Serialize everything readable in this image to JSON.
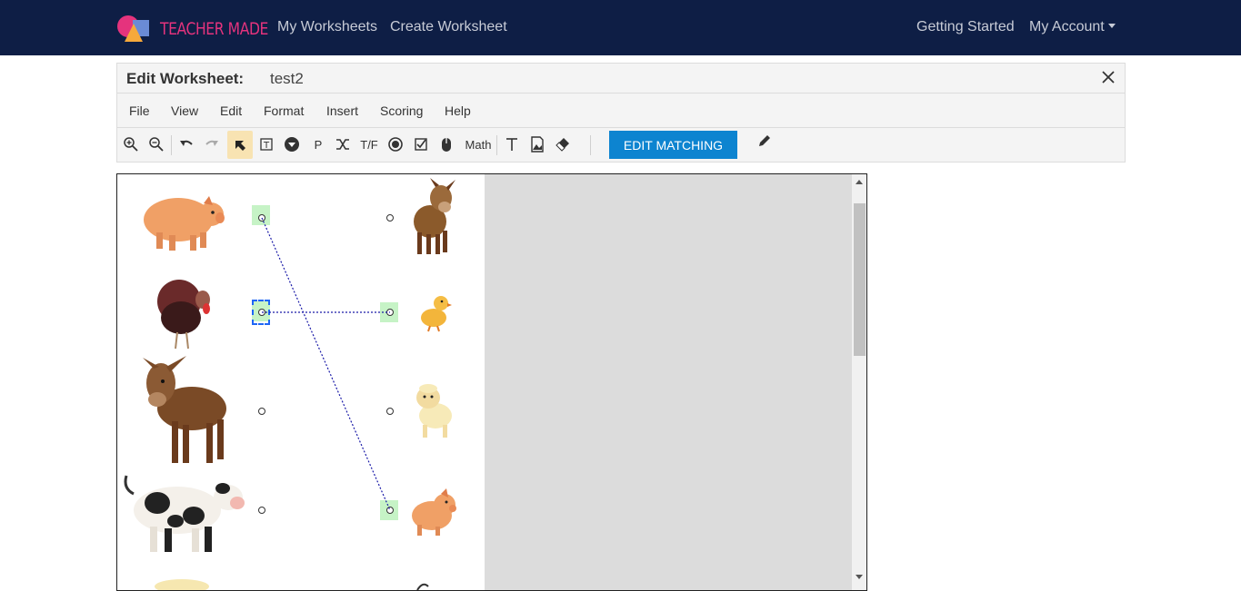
{
  "nav": {
    "logo_text": "TEACHER MADE",
    "links": [
      "My Worksheets",
      "Create Worksheet"
    ],
    "right_links": [
      "Getting Started",
      "My Account"
    ]
  },
  "editor": {
    "label": "Edit Worksheet:",
    "worksheet_name": "test2"
  },
  "menu": [
    "File",
    "View",
    "Edit",
    "Format",
    "Insert",
    "Scoring",
    "Help"
  ],
  "toolbar": {
    "tf_label": "T/F",
    "p_label": "P",
    "math_label": "Math",
    "edit_matching_label": "EDIT MATCHING",
    "tools": [
      "zoom-in",
      "zoom-out",
      "undo",
      "redo",
      "select",
      "text-box",
      "dropdown",
      "paragraph",
      "shuffle",
      "true-false",
      "radio",
      "checkbox",
      "mouse",
      "math",
      "text",
      "image",
      "eraser",
      "pencil"
    ]
  },
  "worksheet": {
    "left_items": [
      "pig",
      "turkey",
      "donkey",
      "cow"
    ],
    "right_items": [
      "donkey",
      "duckling",
      "lamb",
      "piglet"
    ],
    "connections": [
      [
        "pig",
        "piglet"
      ],
      [
        "turkey",
        "duckling"
      ]
    ]
  },
  "colors": {
    "nav_bg": "#0e1e45",
    "button_blue": "#0d84d0",
    "match_green": "#c6f3c6",
    "line_blue": "#1a1aa8"
  }
}
